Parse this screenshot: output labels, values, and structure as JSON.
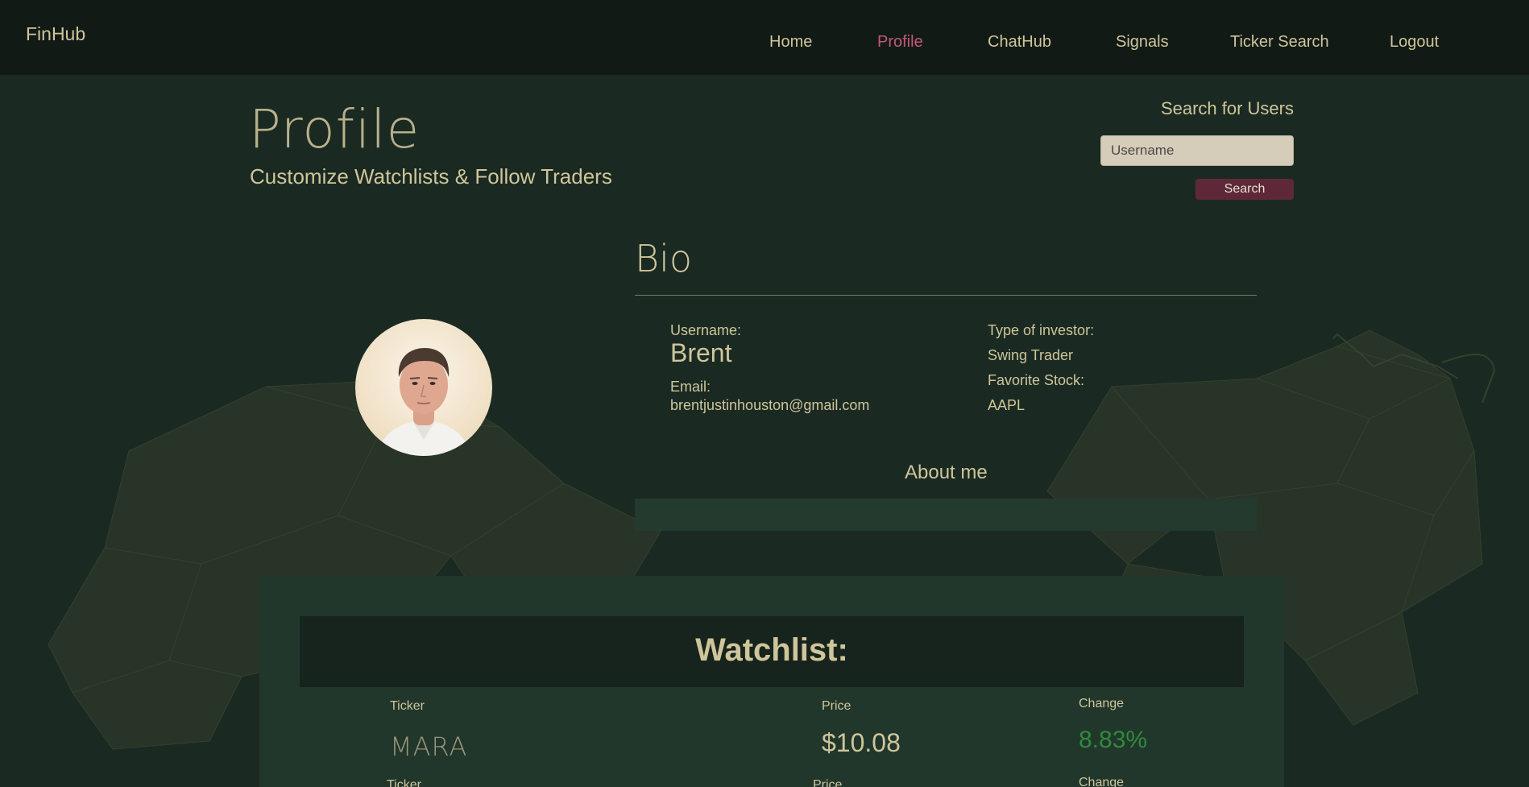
{
  "nav": {
    "brand": "FinHub",
    "items": [
      {
        "label": "Home",
        "active": false
      },
      {
        "label": "Profile",
        "active": true
      },
      {
        "label": "ChatHub",
        "active": false
      },
      {
        "label": "Signals",
        "active": false
      },
      {
        "label": "Ticker Search",
        "active": false
      },
      {
        "label": "Logout",
        "active": false
      }
    ]
  },
  "header": {
    "title": "Profile",
    "subtitle": "Customize Watchlists & Follow Traders"
  },
  "user_search": {
    "heading": "Search for Users",
    "placeholder": "Username",
    "value": "",
    "button_label": "Search"
  },
  "bio": {
    "title": "Bio",
    "username_label": "Username:",
    "username": "Brent",
    "email_label": "Email:",
    "email": "brentjustinhouston@gmail.com",
    "investor_type_label": "Type of investor:",
    "investor_type": "Swing Trader",
    "favorite_stock_label": "Favorite Stock:",
    "favorite_stock": "AAPL",
    "about_heading": "About me",
    "about_text": ""
  },
  "watchlist": {
    "title": "Watchlist:",
    "rows": [
      {
        "ticker_label": "Ticker",
        "ticker": "MARA",
        "price_label": "Price",
        "price": "$10.08",
        "change_label": "Change",
        "change": "8.83%"
      },
      {
        "ticker_label": "Ticker",
        "ticker": "",
        "price_label": "Price",
        "price": "",
        "change_label": "Change",
        "change": ""
      }
    ]
  },
  "colors": {
    "background": "#1a2a22",
    "navbar": "#121a16",
    "text": "#cfc59a",
    "active_nav": "#c2577c",
    "search_button": "#5e2839",
    "positive_change": "#2f8a3a"
  }
}
